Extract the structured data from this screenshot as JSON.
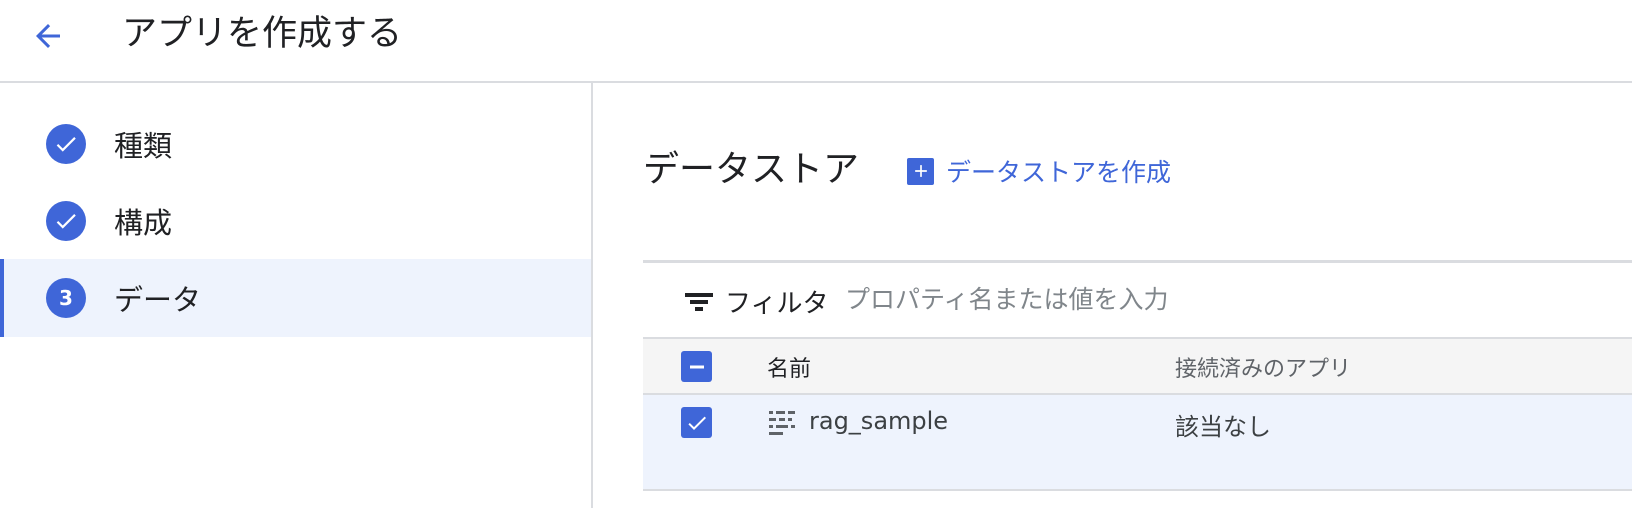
{
  "header": {
    "back_icon": "arrow-back-icon",
    "title": "アプリを作成する"
  },
  "colors": {
    "accent": "#3f66d8",
    "active_bg": "#eef3fd",
    "divider": "#dadce0"
  },
  "stepper": {
    "steps": [
      {
        "label": "種類",
        "state": "completed",
        "icon": "check-icon"
      },
      {
        "label": "構成",
        "state": "completed",
        "icon": "check-icon"
      },
      {
        "label": "データ",
        "state": "active",
        "number": "3"
      }
    ]
  },
  "main": {
    "section_title": "データストア",
    "create_link": {
      "icon": "plus-box-icon",
      "label": "データストアを作成"
    },
    "filter": {
      "icon": "filter-icon",
      "label": "フィルタ",
      "placeholder": "プロパティ名または値を入力",
      "value": ""
    },
    "table": {
      "header_checkbox_state": "indeterminate",
      "columns": [
        "名前",
        "接続済みのアプリ"
      ],
      "rows": [
        {
          "selected": true,
          "icon": "datastore-icon",
          "name": "rag_sample",
          "connected_apps": "該当なし"
        }
      ]
    }
  }
}
